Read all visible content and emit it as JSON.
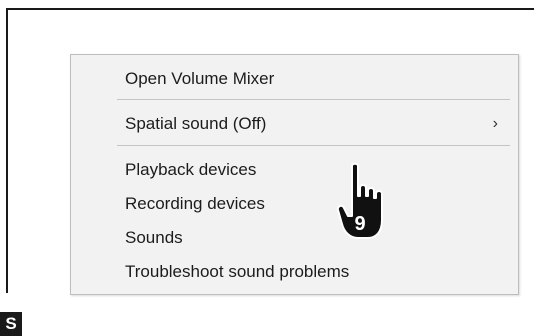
{
  "menu": {
    "items": [
      {
        "label": "Open Volume Mixer"
      },
      {
        "label": "Spatial sound (Off)",
        "submenu_glyph": "›"
      },
      {
        "label": "Playback devices"
      },
      {
        "label": "Recording devices"
      },
      {
        "label": "Sounds"
      },
      {
        "label": "Troubleshoot sound problems"
      }
    ]
  },
  "callout": {
    "step_number": "9",
    "icon": "pointing-hand-icon"
  },
  "section_tag": "S",
  "colors": {
    "menu_background": "#f2f2f2",
    "separator": "#c4c4c4",
    "hand_fill": "#111111",
    "tag_background": "#1a1a1a"
  }
}
